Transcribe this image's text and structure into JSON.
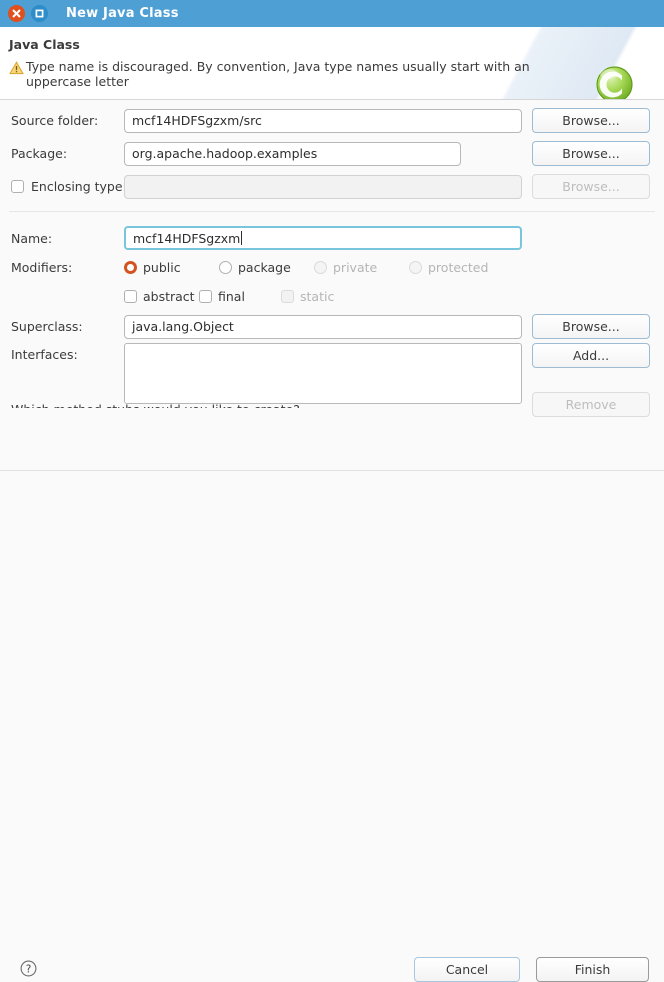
{
  "window": {
    "title": "New Java Class",
    "close_icon": "close-icon",
    "maximize_icon": "maximize-icon"
  },
  "banner": {
    "title": "Java Class",
    "warning_icon": "warning-icon",
    "warning_text": "Type name is discouraged. By convention, Java type names usually start with an uppercase letter",
    "page_icon": "new-class-icon"
  },
  "form": {
    "source_folder": {
      "label": "Source folder:",
      "value": "mcf14HDFSgzxm/src",
      "browse_label": "Browse..."
    },
    "package": {
      "label": "Package:",
      "value": "org.apache.hadoop.examples",
      "browse_label": "Browse..."
    },
    "enclosing_type": {
      "label": "Enclosing type:",
      "value": "",
      "browse_label": "Browse...",
      "checked": false,
      "enabled": false
    },
    "name": {
      "label": "Name:",
      "value": "mcf14HDFSgzxm"
    },
    "modifiers": {
      "label": "Modifiers:",
      "access": [
        {
          "label": "public",
          "selected": true,
          "enabled": true
        },
        {
          "label": "package",
          "selected": false,
          "enabled": true
        },
        {
          "label": "private",
          "selected": false,
          "enabled": false
        },
        {
          "label": "protected",
          "selected": false,
          "enabled": false
        }
      ],
      "flags": [
        {
          "label": "abstract",
          "checked": false,
          "enabled": true
        },
        {
          "label": "final",
          "checked": false,
          "enabled": true
        },
        {
          "label": "static",
          "checked": false,
          "enabled": false
        }
      ]
    },
    "superclass": {
      "label": "Superclass:",
      "value": "java.lang.Object",
      "browse_label": "Browse..."
    },
    "interfaces": {
      "label": "Interfaces:",
      "items": [],
      "add_label": "Add...",
      "remove_label": "Remove"
    },
    "method_stubs_label": "Which method stubs would you like to create?"
  },
  "footer": {
    "help_icon": "help-icon",
    "cancel_label": "Cancel",
    "finish_label": "Finish"
  },
  "colors": {
    "titlebar": "#4d9fd4",
    "close_button": "#e0501e",
    "radio_selected": "#d4541f",
    "focus_border": "#79c6dc",
    "body_background": "#fafafa"
  }
}
